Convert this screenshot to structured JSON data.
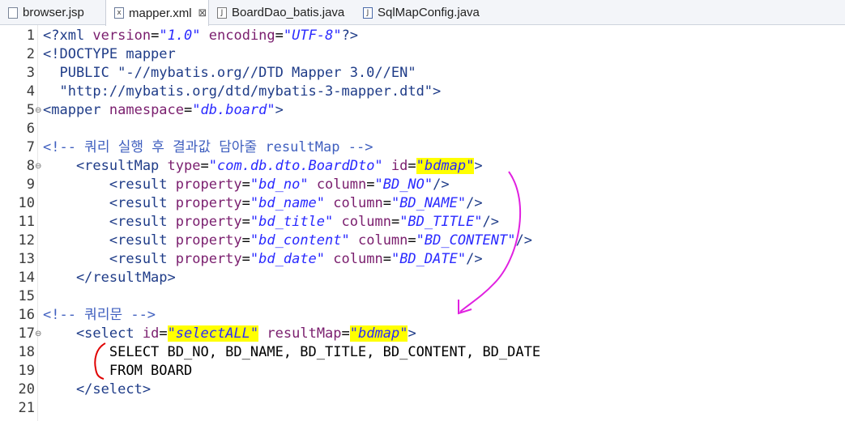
{
  "tabs": [
    {
      "label": "browser.jsp",
      "icon": "jsp-file-icon"
    },
    {
      "label": "mapper.xml",
      "icon": "xml-file-icon",
      "active": true
    },
    {
      "label": "BoardDao_batis.java",
      "icon": "java-file-icon"
    },
    {
      "label": "SqlMapConfig.java",
      "icon": "java-file-icon"
    }
  ],
  "close_glyph": "⊠",
  "fold_glyph": "⊖",
  "lines": [
    {
      "n": "1",
      "seg": [
        [
          "<?xml ",
          "pi"
        ],
        [
          "version",
          "attr"
        ],
        [
          "=",
          "txt"
        ],
        [
          "\"1.0\"",
          "str"
        ],
        [
          " ",
          "txt"
        ],
        [
          "encoding",
          "attr"
        ],
        [
          "=",
          "txt"
        ],
        [
          "\"UTF-8\"",
          "str"
        ],
        [
          "?>",
          "pi"
        ]
      ]
    },
    {
      "n": "2",
      "seg": [
        [
          "<!DOCTYPE mapper",
          "dt"
        ]
      ]
    },
    {
      "n": "3",
      "seg": [
        [
          "  PUBLIC \"-//mybatis.org//DTD Mapper 3.0//EN\"",
          "dt"
        ]
      ]
    },
    {
      "n": "4",
      "seg": [
        [
          "  \"http://mybatis.org/dtd/mybatis-3-mapper.dtd\">",
          "dt"
        ]
      ]
    },
    {
      "n": "5",
      "fold": true,
      "seg": [
        [
          "<mapper ",
          "tag"
        ],
        [
          "namespace",
          "attr"
        ],
        [
          "=",
          "txt"
        ],
        [
          "\"db.board\"",
          "str"
        ],
        [
          ">",
          "tag"
        ]
      ]
    },
    {
      "n": "6",
      "seg": []
    },
    {
      "n": "7",
      "seg": [
        [
          "<!-- 쿼리 실행 후 결과값 담아줄 resultMap -->",
          "com"
        ]
      ]
    },
    {
      "n": "8",
      "fold": true,
      "seg": [
        [
          "    <resultMap ",
          "tag"
        ],
        [
          "type",
          "attr"
        ],
        [
          "=",
          "txt"
        ],
        [
          "\"com.db.dto.BoardDto\"",
          "str"
        ],
        [
          " ",
          "txt"
        ],
        [
          "id",
          "attr"
        ],
        [
          "=",
          "txt"
        ],
        [
          "\"bdmap\"",
          "str hl"
        ],
        [
          ">",
          "tag"
        ]
      ]
    },
    {
      "n": "9",
      "seg": [
        [
          "        <result ",
          "tag"
        ],
        [
          "property",
          "attr"
        ],
        [
          "=",
          "txt"
        ],
        [
          "\"bd_no\"",
          "str"
        ],
        [
          " ",
          "txt"
        ],
        [
          "column",
          "attr"
        ],
        [
          "=",
          "txt"
        ],
        [
          "\"BD_NO\"",
          "str"
        ],
        [
          "/>",
          "tag"
        ]
      ]
    },
    {
      "n": "10",
      "seg": [
        [
          "        <result ",
          "tag"
        ],
        [
          "property",
          "attr"
        ],
        [
          "=",
          "txt"
        ],
        [
          "\"bd_name\"",
          "str"
        ],
        [
          " ",
          "txt"
        ],
        [
          "column",
          "attr"
        ],
        [
          "=",
          "txt"
        ],
        [
          "\"BD_NAME\"",
          "str"
        ],
        [
          "/>",
          "tag"
        ]
      ]
    },
    {
      "n": "11",
      "seg": [
        [
          "        <result ",
          "tag"
        ],
        [
          "property",
          "attr"
        ],
        [
          "=",
          "txt"
        ],
        [
          "\"bd_title\"",
          "str"
        ],
        [
          " ",
          "txt"
        ],
        [
          "column",
          "attr"
        ],
        [
          "=",
          "txt"
        ],
        [
          "\"BD_TITLE\"",
          "str"
        ],
        [
          "/>",
          "tag"
        ]
      ]
    },
    {
      "n": "12",
      "seg": [
        [
          "        <result ",
          "tag"
        ],
        [
          "property",
          "attr"
        ],
        [
          "=",
          "txt"
        ],
        [
          "\"bd_content\"",
          "str"
        ],
        [
          " ",
          "txt"
        ],
        [
          "column",
          "attr"
        ],
        [
          "=",
          "txt"
        ],
        [
          "\"BD_CONTENT\"",
          "str"
        ],
        [
          "/>",
          "tag"
        ]
      ]
    },
    {
      "n": "13",
      "seg": [
        [
          "        <result ",
          "tag"
        ],
        [
          "property",
          "attr"
        ],
        [
          "=",
          "txt"
        ],
        [
          "\"bd_date\"",
          "str"
        ],
        [
          " ",
          "txt"
        ],
        [
          "column",
          "attr"
        ],
        [
          "=",
          "txt"
        ],
        [
          "\"BD_DATE\"",
          "str"
        ],
        [
          "/>",
          "tag"
        ]
      ]
    },
    {
      "n": "14",
      "seg": [
        [
          "    </resultMap>",
          "tag"
        ]
      ]
    },
    {
      "n": "15",
      "seg": []
    },
    {
      "n": "16",
      "seg": [
        [
          "<!-- 쿼리문 -->",
          "com"
        ]
      ]
    },
    {
      "n": "17",
      "fold": true,
      "seg": [
        [
          "    <select ",
          "tag"
        ],
        [
          "id",
          "attr"
        ],
        [
          "=",
          "txt"
        ],
        [
          "\"selectALL\"",
          "str hl"
        ],
        [
          " ",
          "txt"
        ],
        [
          "resultMap",
          "attr"
        ],
        [
          "=",
          "txt"
        ],
        [
          "\"bdmap\"",
          "str hl"
        ],
        [
          ">",
          "tag"
        ]
      ]
    },
    {
      "n": "18",
      "seg": [
        [
          "        SELECT BD_NO, BD_NAME, BD_TITLE, BD_CONTENT, BD_DATE",
          "txt"
        ]
      ]
    },
    {
      "n": "19",
      "seg": [
        [
          "        FROM BOARD",
          "txt"
        ]
      ]
    },
    {
      "n": "20",
      "seg": [
        [
          "    </select>",
          "tag"
        ]
      ]
    },
    {
      "n": "21",
      "seg": []
    }
  ],
  "colors": {
    "tag": "#1f3c88",
    "attr": "#7a1e6e",
    "string": "#2a2aff",
    "comment": "#3f5fbf",
    "highlight": "#ffff00",
    "annotation_arrow": "#e020e0",
    "annotation_bracket": "#e00000"
  }
}
